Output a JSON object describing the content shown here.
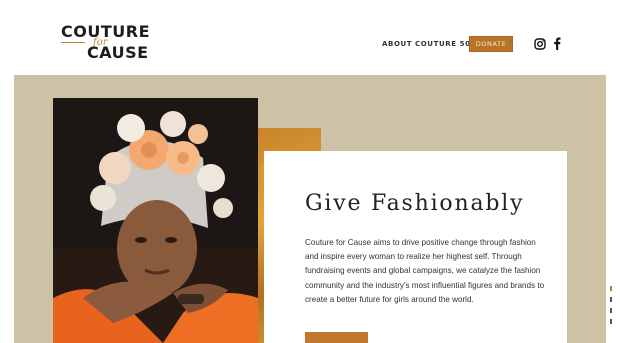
{
  "header": {
    "logo": {
      "line1": "COUTURE",
      "line2": "CAUSE",
      "connector": "for"
    },
    "nav": [
      {
        "label": "ABOUT"
      },
      {
        "label": "COUTURE 50"
      }
    ],
    "donate_label": "DONATE",
    "social": [
      {
        "icon": "instagram-icon"
      },
      {
        "icon": "facebook-icon"
      }
    ]
  },
  "hero": {
    "title": "Give Fashionably",
    "body": "Couture for Cause aims to drive positive change through fashion and inspire every woman to realize her highest self. Through fundraising events and global campaigns, we catalyze the fashion community and the industry's most influential figures and brands to create a better future for girls around the world.",
    "colors": {
      "background": "#cdc2a6",
      "accent": "#c0782f",
      "gold": "#d59a36"
    }
  }
}
